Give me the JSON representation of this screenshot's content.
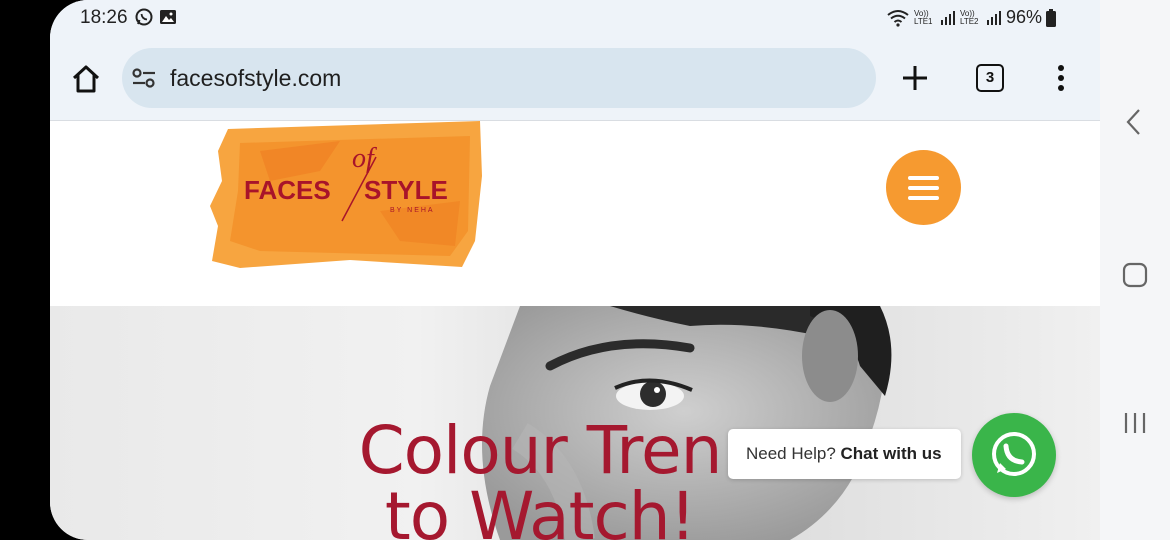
{
  "status_bar": {
    "time": "18:26",
    "net1": "Vo)) LTE1",
    "net2": "Vo)) LTE2",
    "battery": "96%",
    "icons": [
      "whatsapp-icon",
      "gallery-icon",
      "wifi-icon",
      "signal-icon",
      "signal-icon",
      "battery-icon"
    ]
  },
  "browser": {
    "url": "facesofstyle.com",
    "tab_count": "3"
  },
  "site": {
    "logo_word1": "FACES",
    "logo_of": "of",
    "logo_word2": "STYLE",
    "logo_by": "BY NEHA",
    "hero_line1": "Colour Tren",
    "hero_line2": "to Watch!",
    "chat_prefix": "Need Help?",
    "chat_strong": "Chat with us"
  },
  "colors": {
    "accent_orange": "#f69a30",
    "title_red": "#a5182f",
    "whatsapp_green": "#3ab54a",
    "url_bar": "#d8e5ef"
  }
}
